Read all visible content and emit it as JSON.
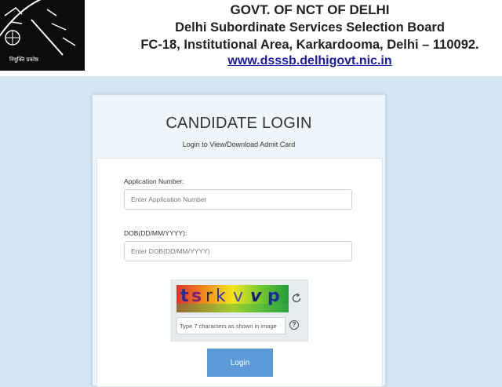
{
  "header": {
    "line1": "GOVT. OF NCT OF DELHI",
    "line2": "Delhi Subordinate Services Selection Board",
    "line3": "FC-18, Institutional Area, Karkardooma, Delhi – 110092.",
    "website": "www.dsssb.delhigovt.nic.in",
    "logo_text": "नियुक्ति प्रकोष्ठ"
  },
  "login": {
    "title": "CANDIDATE LOGIN",
    "subtitle": "Login to View/Download Admit Card",
    "app_number_label": "Application Number:",
    "app_number_placeholder": "Enter Application Number",
    "app_number_value": "",
    "dob_label": "DOB(DD/MM/YYYY):",
    "dob_placeholder": "Enter DOB(DD/MM/YYYY)",
    "dob_value": "",
    "captcha_chars": [
      "t",
      "s",
      "r",
      "k",
      "v",
      "v",
      "p"
    ],
    "captcha_placeholder": "Type 7 characters as shown in image",
    "captcha_value": "",
    "help_symbol": "?",
    "login_button": "Login"
  },
  "colors": {
    "page_background": "#d4e6f3",
    "button": "#5b9ad6",
    "link": "#1a1aa6"
  }
}
